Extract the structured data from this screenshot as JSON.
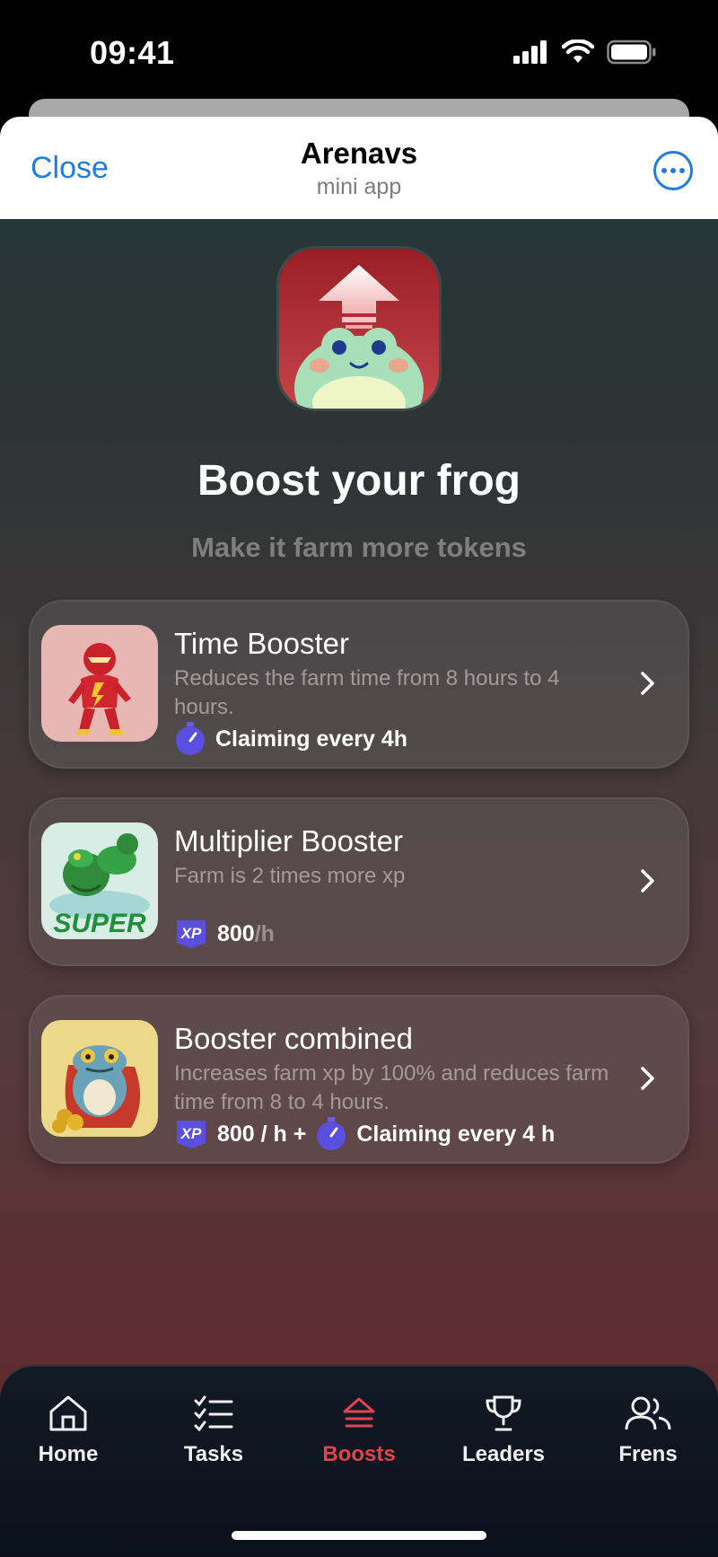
{
  "status": {
    "time": "09:41"
  },
  "nav": {
    "close_label": "Close",
    "title": "Arenavs",
    "subtitle": "mini app"
  },
  "hero": {
    "title": "Boost your frog",
    "subtitle": "Make it farm more tokens"
  },
  "boosters": [
    {
      "title": "Time Booster",
      "description": "Reduces the farm time from 8 hours to 4 hours.",
      "metric": "Claiming every 4h"
    },
    {
      "title": "Multiplier Booster",
      "description": "Farm is 2 times more xp",
      "metric_value": "800",
      "metric_unit": "/h"
    },
    {
      "title": "Booster combined",
      "description": "Increases farm xp by 100% and reduces farm time from 8 to 4 hours.",
      "metric_xp": "800 / h +",
      "metric_time": "Claiming every 4 h"
    }
  ],
  "tabs": [
    {
      "label": "Home",
      "icon": "home-icon"
    },
    {
      "label": "Tasks",
      "icon": "tasks-icon"
    },
    {
      "label": "Boosts",
      "icon": "boost-icon",
      "active": true
    },
    {
      "label": "Leaders",
      "icon": "trophy-icon"
    },
    {
      "label": "Frens",
      "icon": "friends-icon"
    }
  ],
  "colors": {
    "accent": "#1f7de0",
    "active_tab": "#e0444c",
    "xp_badge": "#5b4fe0"
  }
}
